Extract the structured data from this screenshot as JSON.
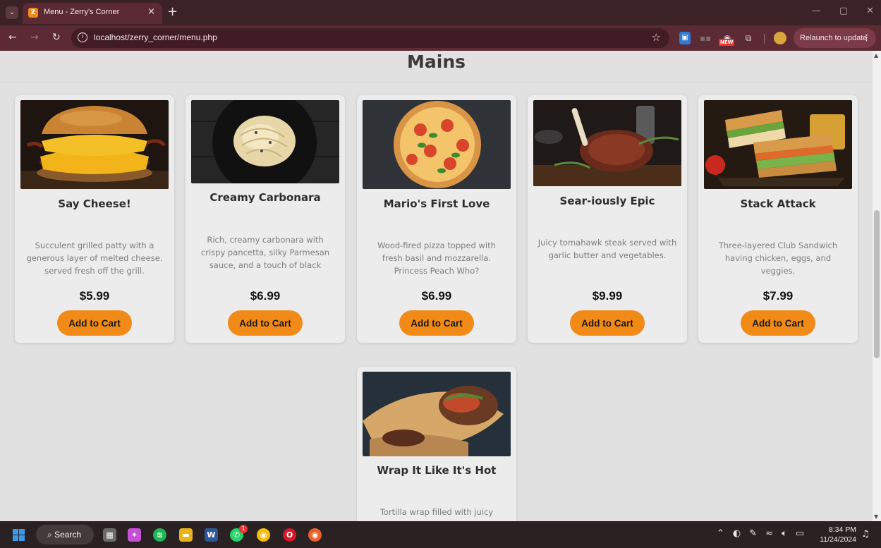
{
  "browser": {
    "tab_title": "Menu - Zerry's Corner",
    "tab_close": "×",
    "new_tab": "+",
    "url": "localhost/zerry_corner/menu.php",
    "relaunch_label": "Relaunch to update",
    "ext_badge": "NEW"
  },
  "page": {
    "section_title": "Mains",
    "items": [
      {
        "name": "Say Cheese!",
        "description": "Succulent grilled patty with a generous layer of melted cheese. served fresh off the grill.",
        "price": "$5.99",
        "button": "Add to Cart",
        "image": "burger"
      },
      {
        "name": "Creamy Carbonara",
        "description": "Rich, creamy carbonara with crispy pancetta, silky Parmesan sauce, and a touch of black",
        "price": "$6.99",
        "button": "Add to Cart",
        "image": "pasta"
      },
      {
        "name": "Mario's First Love",
        "description": "Wood-fired pizza topped with fresh basil and mozzarella. Princess Peach Who?",
        "price": "$6.99",
        "button": "Add to Cart",
        "image": "pizza"
      },
      {
        "name": "Sear-iously Epic",
        "description": "Juicy tomahawk steak served with garlic butter and vegetables.",
        "price": "$9.99",
        "button": "Add to Cart",
        "image": "steak"
      },
      {
        "name": "Stack Attack",
        "description": "Three-layered Club Sandwich having chicken, eggs, and veggies.",
        "price": "$7.99",
        "button": "Add to Cart",
        "image": "sandwich"
      },
      {
        "name": "Wrap It Like It's Hot",
        "description": "Tortilla wrap filled with juicy",
        "price": "",
        "button": "",
        "image": "wrap"
      }
    ]
  },
  "taskbar": {
    "search_label": "Search",
    "time": "8:34 PM",
    "date": "11/24/2024",
    "whatsapp_badge": "1"
  },
  "colors": {
    "accent": "#f28a17",
    "page_bg": "#e1e1e1",
    "card_bg": "#ececec",
    "chrome": "#5c2a34"
  }
}
